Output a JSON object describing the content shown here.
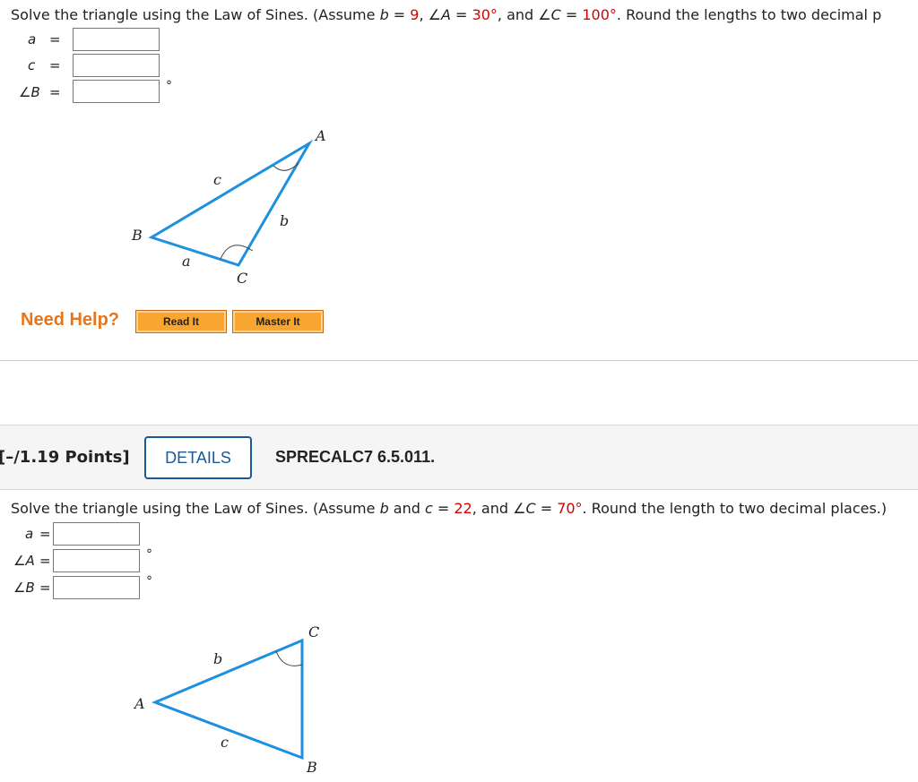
{
  "problem1": {
    "prompt_prefix": "Solve the triangle using the Law of Sines. (Assume ",
    "b_var": "b",
    "b_eq": " = ",
    "b_val": "9",
    "sep1": ",  ",
    "angA": "∠A",
    "angA_eq": " = ",
    "angA_val": "30°",
    "sep2": ",  and  ",
    "angC": "∠C",
    "angC_eq": " = ",
    "angC_val": "100°",
    "suffix": ".  Round the lengths to two decimal p",
    "fields": [
      {
        "label": "a",
        "eq": "="
      },
      {
        "label": "c",
        "eq": "="
      },
      {
        "label": "∠B",
        "eq": "=",
        "unit": "°"
      }
    ],
    "diagram": {
      "A": "A",
      "B": "B",
      "C": "C",
      "a": "a",
      "b": "b",
      "c": "c"
    }
  },
  "help": {
    "label": "Need Help?",
    "read_it": "Read It",
    "master_it": "Master It"
  },
  "problem2_header": {
    "points": "[–/1.19 Points]",
    "details": "DETAILS",
    "code": "SPRECALC7 6.5.011."
  },
  "problem2": {
    "prompt_prefix": "Solve the triangle using the Law of Sines. (Assume ",
    "b_var": "b",
    "and": " and ",
    "c_var": "c",
    "c_eq": " = ",
    "c_val": "22",
    "sep": ", and ",
    "angC": "∠C",
    "angC_eq": " = ",
    "angC_val": "70°",
    "suffix": ". Round the length to two decimal places.)",
    "fields": [
      {
        "label": "a",
        "eq": "="
      },
      {
        "label": "∠A",
        "eq": "=",
        "unit": "°"
      },
      {
        "label": "∠B",
        "eq": "=",
        "unit": "°"
      }
    ],
    "diagram": {
      "A": "A",
      "B": "B",
      "C": "C",
      "b": "b",
      "c": "c"
    }
  },
  "colors": {
    "accent_red": "#d40000",
    "triangle_blue": "#1e90e0",
    "help_orange": "#e8751a",
    "details_blue": "#1b5a95"
  }
}
